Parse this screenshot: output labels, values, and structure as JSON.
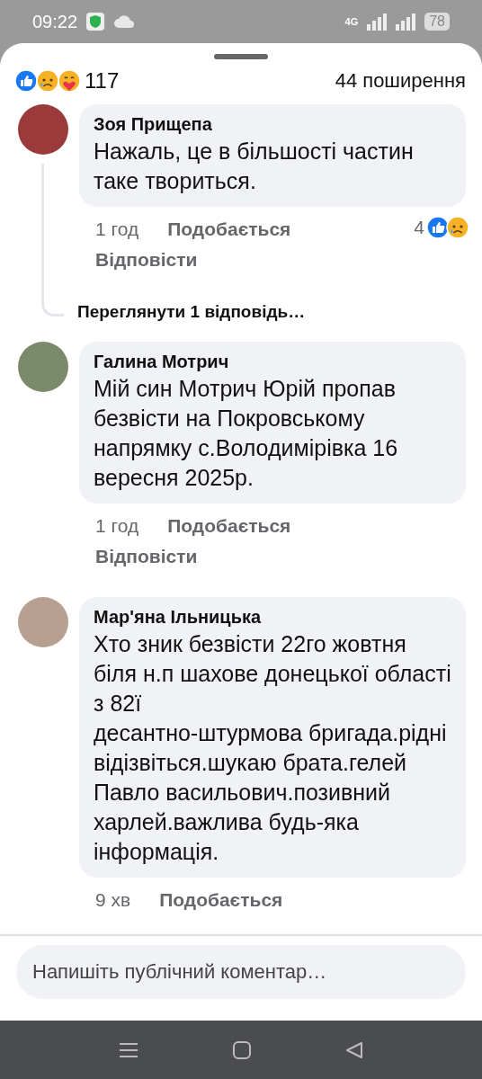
{
  "status_bar": {
    "time": "09:22",
    "network": "4G",
    "battery": "78"
  },
  "reactions_summary": {
    "count": "117",
    "shares": "44 поширення"
  },
  "comments": [
    {
      "author": "Зоя Прищепа",
      "text": "Нажаль, це в більшості частин таке твориться.",
      "time": "1 год",
      "like_label": "Подобається",
      "reply_label": "Відповісти",
      "reaction_count": "4",
      "replies_link": "Переглянути 1 відповідь…"
    },
    {
      "author": "Галина Мотрич",
      "text": "Мій син Мотрич Юрій пропав безвісти на Покровському напрямку с.Володимірівка 16 вересня 2025р.",
      "time": "1 год",
      "like_label": "Подобається",
      "reply_label": "Відповісти"
    },
    {
      "author": "Мар'яна Ільницька",
      "text": "Хто зник безвісти 22го жовтня біля н.п шахове донецької області з 82ї\nдесантно-штурмова бригада.рідні відізвіться.шукаю брата.гелей Павло васильович.позивний харлей.важлива будь-яка інформація.",
      "time": "9 хв",
      "like_label": "Подобається"
    }
  ],
  "composer": {
    "placeholder": "Напишіть публічний коментар…"
  }
}
